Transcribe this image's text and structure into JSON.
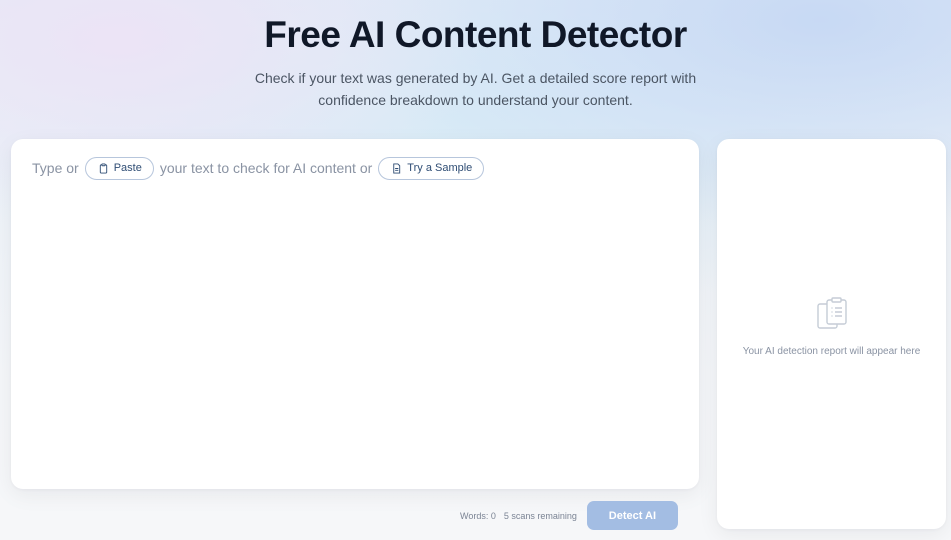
{
  "hero": {
    "title": "Free AI Content Detector",
    "subtitle": "Check if your text was generated by AI. Get a detailed score report with confidence breakdown to understand your content."
  },
  "editor": {
    "prompt_prefix": "Type or",
    "paste_label": "Paste",
    "prompt_middle": "your text to check for AI content or",
    "sample_label": "Try a Sample"
  },
  "footer": {
    "word_count": "Words: 0",
    "scans_remaining": "5 scans remaining",
    "detect_label": "Detect AI"
  },
  "report": {
    "placeholder": "Your AI detection report will appear here"
  },
  "icons": {
    "paste": "clipboard-icon",
    "sample": "document-icon",
    "report": "clipboard-list-icon"
  },
  "colors": {
    "title": "#101828",
    "accent_button": "#a3bde3",
    "pill_border": "#b7c6dc",
    "pill_text": "#2f4d74",
    "muted_text": "#8a93a3"
  }
}
